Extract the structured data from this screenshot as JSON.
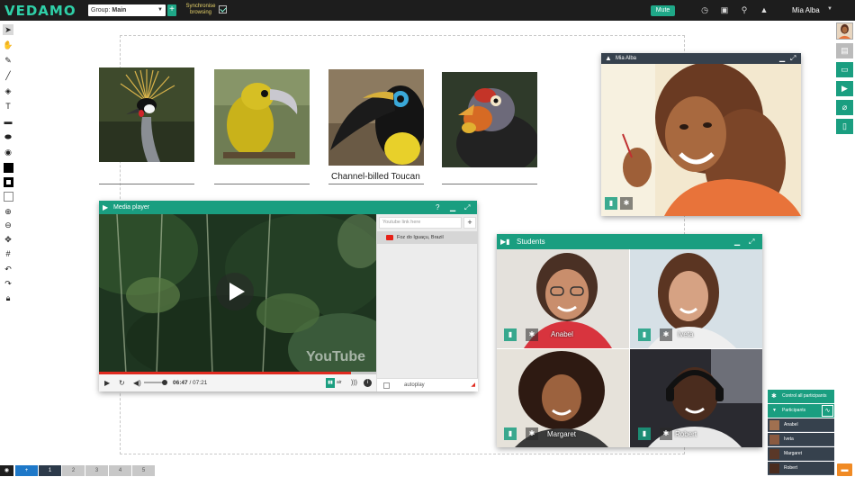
{
  "app": {
    "logo": "VEDAMO",
    "group_label": "Group:",
    "group_value": "Main",
    "sync_label": "Synchronise browsing",
    "mute_label": "Mute",
    "user_name": "Mia Alba"
  },
  "board": {
    "caption_toucan": "Channel-billed Toucan"
  },
  "media_player": {
    "title": "Media player",
    "help": "?",
    "url_placeholder": "Youtube link here",
    "playlist_item": "Foz do Iguaçu, Brazil",
    "autoplay_label": "autoplay",
    "time_current": "06:47",
    "time_total": "/ 07:21",
    "air_label": "air",
    "watermark": "YouTube",
    "progress": 0.91
  },
  "mia_window": {
    "title": "Mia Alba"
  },
  "students": {
    "title": "Students",
    "tiles": [
      {
        "name": "Anabel"
      },
      {
        "name": "Iveta"
      },
      {
        "name": "Margaret"
      },
      {
        "name": "Robert"
      }
    ]
  },
  "participants": {
    "control_all": "Control all participants",
    "header": "Participants",
    "list": [
      "Anabel",
      "Iveta",
      "Margaret",
      "Robert"
    ]
  },
  "pages": [
    "1",
    "2",
    "3",
    "4",
    "5"
  ],
  "colors": {
    "accent": "#1a9e80",
    "topbar": "#1d1d1d",
    "dark_panel": "#36414d",
    "logo": "#2fd0a8"
  }
}
